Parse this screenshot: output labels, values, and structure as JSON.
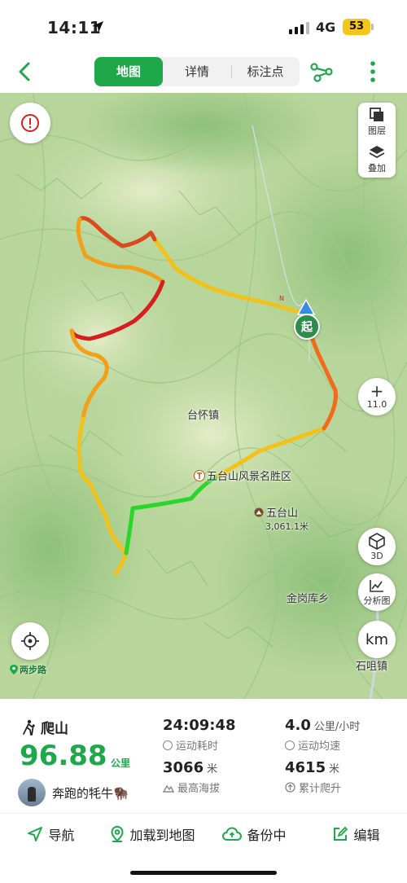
{
  "status": {
    "time": "14:11",
    "network": "4G",
    "battery": "53"
  },
  "nav": {
    "tabs": [
      {
        "label": "地图",
        "active": true
      },
      {
        "label": "详情",
        "active": false
      },
      {
        "label": "标注点",
        "active": false
      }
    ]
  },
  "map": {
    "layers_label": "图层",
    "overlay_label": "叠加",
    "zoom_level": "11.0",
    "view_3d_label": "3D",
    "analysis_label": "分析图",
    "unit_toggle": "km",
    "start_marker": "起",
    "north_marker": "N",
    "brand": "两步路",
    "places": {
      "town_taihuai": "台怀镇",
      "scenic_area": "五台山风景名胜区",
      "mountain_name": "五台山",
      "mountain_elevation": "3,061.1米",
      "town_jingangku": "金岗库乡",
      "town_shizui": "石咀镇"
    },
    "colors": {
      "accent": "#1fa84a",
      "track_fast": "#2bd62b",
      "track_mid": "#f2c21a",
      "track_slow": "#d81e1e"
    }
  },
  "summary": {
    "activity": "爬山",
    "distance": "96.88",
    "distance_unit": "公里",
    "user": "奔跑的牦牛🦬",
    "duration": "24:09:48",
    "duration_label": "运动耗时",
    "speed": "4.0",
    "speed_unit": "公里/小时",
    "speed_label": "运动均速",
    "max_alt": "3066",
    "max_alt_unit": "米",
    "max_alt_label": "最高海拔",
    "ascent": "4615",
    "ascent_unit": "米",
    "ascent_label": "累计爬升"
  },
  "toolbar": {
    "navigate": "导航",
    "load_to_map": "加载到地图",
    "backup": "备份中",
    "edit": "编辑"
  }
}
